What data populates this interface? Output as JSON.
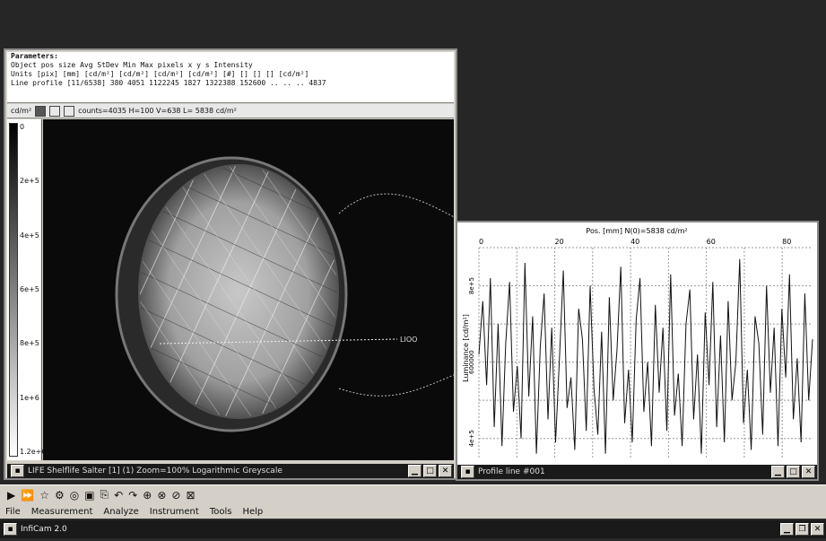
{
  "app": {
    "title": "InfiCam 2.0"
  },
  "menu": [
    "File",
    "Measurement",
    "Analyze",
    "Instrument",
    "Tools",
    "Help"
  ],
  "toolbar": [
    "▶",
    "⏩",
    "☆",
    "⚙",
    "◎",
    "▣",
    "⎘",
    "↶",
    "↷",
    "⊕",
    "⊗",
    "⊘",
    "⊠"
  ],
  "image_window": {
    "title": "LIFE Shelflife Salter [1] (1) Zoom=100% Logarithmic Greyscale",
    "stats_header": "Parameters:",
    "stats_rows": [
      "Object        pos    size  Avg    StDev  Min    Max    pixels  x  y  s  Intensity",
      "Units         [pix]  [mm] [cd/m²] [cd/m²] [cd/m²] [cd/m²] [#]  [] [] [] [cd/m²]",
      "Line profile  [11/6538] 380  4051  1122245  1827  1322388  152600  ..  ..  ..  4837"
    ],
    "cursor_info": "counts=4035 H=100 V=638 L= 5838 cd/m²",
    "colorbar_unit": "cd/m²",
    "colorbar_ticks": [
      "0",
      "2e+5",
      "4e+5",
      "6e+5",
      "8e+5",
      "1e+6",
      "1.2e+6"
    ],
    "roi_label": "LIOO"
  },
  "profile_window": {
    "title": "Profile line #001",
    "x_title": "Pos. [mm] N(0)=5838 cd/m²",
    "y_title": "Luminance [cd/m²]",
    "x_ticks": [
      "0",
      "20",
      "40",
      "60",
      "80"
    ],
    "y_ticks": [
      "4e+5",
      "600000",
      "8e+5"
    ]
  },
  "chart_data": {
    "type": "line",
    "title": "",
    "xlabel": "Pos. [mm] N(0)=5838 cd/m²",
    "ylabel": "Luminance [cd/m²]",
    "xlim": [
      0,
      88
    ],
    "ylim": [
      350000,
      900000
    ],
    "series": [
      {
        "values": [
          620000,
          760000,
          540000,
          820000,
          430000,
          700000,
          380000,
          650000,
          810000,
          470000,
          590000,
          400000,
          860000,
          510000,
          720000,
          360000,
          640000,
          780000,
          450000,
          690000,
          390000,
          610000,
          840000,
          480000,
          560000,
          370000,
          740000,
          660000,
          420000,
          800000,
          530000,
          410000,
          680000,
          360000,
          770000,
          500000,
          630000,
          850000,
          440000,
          580000,
          390000,
          710000,
          820000,
          470000,
          600000,
          380000,
          750000,
          520000,
          690000,
          420000,
          830000,
          460000,
          570000,
          380000,
          700000,
          790000,
          450000,
          620000,
          360000,
          730000,
          540000,
          810000,
          430000,
          670000,
          390000,
          760000,
          500000,
          600000,
          870000,
          440000,
          580000,
          370000,
          720000,
          650000,
          410000,
          800000,
          520000,
          690000,
          380000,
          740000,
          560000,
          830000,
          450000,
          610000,
          390000,
          780000,
          500000,
          660000
        ]
      }
    ]
  },
  "colors": {
    "trace": "#111111",
    "grid": "#9a9a9a"
  }
}
